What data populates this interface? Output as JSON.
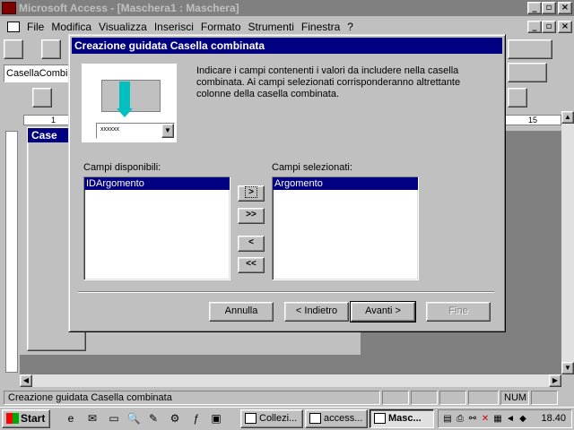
{
  "app": {
    "title": "Microsoft Access - [Maschera1 : Maschera]",
    "minimize": "_",
    "restore": "▫",
    "close": "×"
  },
  "menu": [
    "File",
    "Modifica",
    "Visualizza",
    "Inserisci",
    "Formato",
    "Strumenti",
    "Finestra",
    "?"
  ],
  "toolbar": {
    "object_combo_value": "CasellaCombin"
  },
  "ruler": {
    "marks": [
      "1",
      "15"
    ]
  },
  "toolbox": {
    "title": "Case"
  },
  "dialog": {
    "title": "Creazione guidata Casella combinata",
    "illustration_combo_text": "xxxxxx",
    "description": "Indicare i campi contenenti i valori da includere nella casella combinata. Ai campi selezionati corrisponderanno altrettante colonne della casella combinata.",
    "available_label": "Campi disponibili:",
    "available_fields": [
      "IDArgomento"
    ],
    "selected_label": "Campi selezionati:",
    "selected_fields": [
      "Argomento"
    ],
    "move_buttons": {
      "add_one": ">",
      "add_all": ">>",
      "remove_one": "<",
      "remove_all": "<<"
    },
    "buttons": {
      "cancel": "Annulla",
      "back": "< Indietro",
      "next": "Avanti >",
      "finish": "Fine"
    }
  },
  "status": {
    "text": "Creazione guidata Casella combinata",
    "num": "NUM"
  },
  "taskbar": {
    "start": "Start",
    "tasks": [
      "Collezi...",
      "access...",
      "Masc..."
    ],
    "clock": "18.40"
  }
}
